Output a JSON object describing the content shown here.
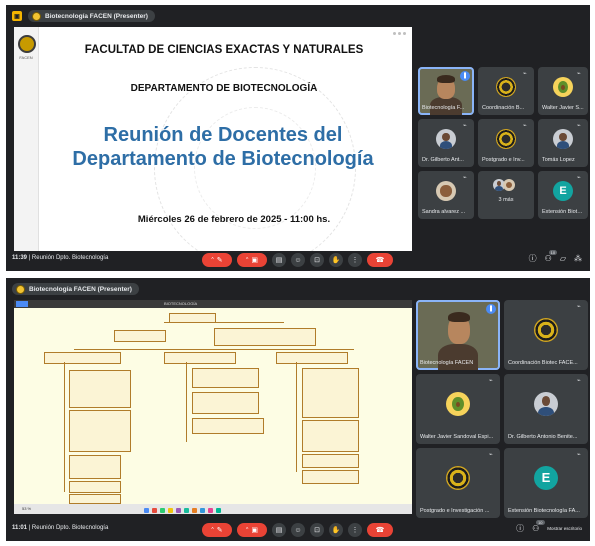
{
  "shot1": {
    "presenter_label": "Biotecnología FACEN (Presenter)",
    "slide": {
      "side_logo_text": "FACEN",
      "faculty": "FACULTAD DE CIENCIAS EXACTAS Y NATURALES",
      "department": "DEPARTAMENTO DE BIOTECNOLOGÍA",
      "title": "Reunión de Docentes del Departamento de Biotecnología",
      "date": "Miércoles 26 de febrero de 2025 - 11:00 hs."
    },
    "tiles": [
      {
        "name": "Biotecnología F...",
        "kind": "camera"
      },
      {
        "name": "Coordinación B...",
        "kind": "seal"
      },
      {
        "name": "Walter Javier S...",
        "kind": "avocado"
      },
      {
        "name": "Dr. Gilberto Ant...",
        "kind": "person"
      },
      {
        "name": "Postgrado e Inv...",
        "kind": "seal"
      },
      {
        "name": "Tomás Lopez",
        "kind": "person"
      },
      {
        "name": "Sandra alvarez ...",
        "kind": "dog"
      },
      {
        "name": "3 más",
        "kind": "more"
      },
      {
        "name": "Extensión Biote...",
        "kind": "letter",
        "letter": "E"
      }
    ],
    "bottom": {
      "time": "11:39",
      "separator": "|",
      "meeting": "Reunión Dpto. Biotecnología",
      "people_count": "10"
    }
  },
  "shot2": {
    "presenter_label": "Biotecnología FACEN (Presenter)",
    "mindmap_tab": "BIOTECNOLOGÍA",
    "mindmap_zoom": "53 %",
    "tiles": [
      {
        "name": "Biotecnología FACEN",
        "kind": "camera"
      },
      {
        "name": "Coordinación Biotec FACE...",
        "kind": "seal"
      },
      {
        "name": "Walter Javier Sandoval Espi...",
        "kind": "avocado"
      },
      {
        "name": "Dr. Gilberto Antonio Benite...",
        "kind": "person"
      },
      {
        "name": "Postgrado e Investigación ...",
        "kind": "seal"
      },
      {
        "name": "Extensión Biotecnología FA...",
        "kind": "letter",
        "letter": "E"
      }
    ],
    "bottom": {
      "time": "11:01",
      "separator": "|",
      "meeting": "Reunión Dpto. Biotecnología",
      "people_count": "10",
      "show_desktop": "Mostrar escritorio"
    }
  },
  "icons": {
    "mic_off": "mic-off-icon",
    "cam_off": "camera-off-icon",
    "captions": "captions-icon",
    "emoji": "emoji-icon",
    "present": "present-icon",
    "hand": "raise-hand-icon",
    "more": "more-options-icon",
    "end": "end-call-icon",
    "info": "info-icon",
    "people": "people-icon",
    "chat": "chat-icon",
    "activities": "activities-icon"
  },
  "colors": {
    "meet_bg": "#202124",
    "tile_bg": "#3c4043",
    "red": "#ea4335",
    "title_blue": "#2e6ea6",
    "highlight": "#8ab4f8"
  }
}
